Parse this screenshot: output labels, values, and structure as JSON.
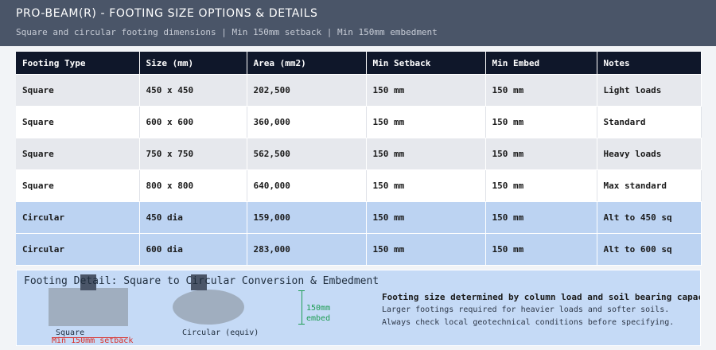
{
  "header": {
    "title": "PRO-BEAM(R) - FOOTING SIZE OPTIONS & DETAILS",
    "subtitle": "Square and circular footing dimensions | Min 150mm setback | Min 150mm embedment"
  },
  "table": {
    "columns": [
      "Footing Type",
      "Size (mm)",
      "Area (mm2)",
      "Min Setback",
      "Min Embed",
      "Notes"
    ],
    "rows": [
      [
        "Square",
        "450 x 450",
        "202,500",
        "150 mm",
        "150 mm",
        "Light loads"
      ],
      [
        "Square",
        "600 x 600",
        "360,000",
        "150 mm",
        "150 mm",
        "Standard"
      ],
      [
        "Square",
        "750 x 750",
        "562,500",
        "150 mm",
        "150 mm",
        "Heavy loads"
      ],
      [
        "Square",
        "800 x 800",
        "640,000",
        "150 mm",
        "150 mm",
        "Max standard"
      ],
      [
        "Circular",
        "450 dia",
        "159,000",
        "150 mm",
        "150 mm",
        "Alt to 450 sq"
      ],
      [
        "Circular",
        "600 dia",
        "283,000",
        "150 mm",
        "150 mm",
        "Alt to 600 sq"
      ]
    ]
  },
  "detail": {
    "title": "Footing Detail: Square to Circular Conversion & Embedment",
    "square_label": "Square",
    "circular_label": "Circular (equiv)",
    "setback_label": "Min 150mm setback",
    "embed_label": "150mm embed",
    "note_bold": "Footing size determined by column load and soil bearing capacity.",
    "note_line1": "Larger footings required for heavier loads and softer soils.",
    "note_line2": "Always check local geotechnical conditions before specifying."
  },
  "colors": {
    "header_bg": "#4a5568",
    "table_header_bg": "#0f172a",
    "circular_row_bg": "#bcd3f2",
    "detail_bg": "#c5daf6",
    "setback_red": "#d9302a",
    "embed_green": "#1f9d55"
  }
}
